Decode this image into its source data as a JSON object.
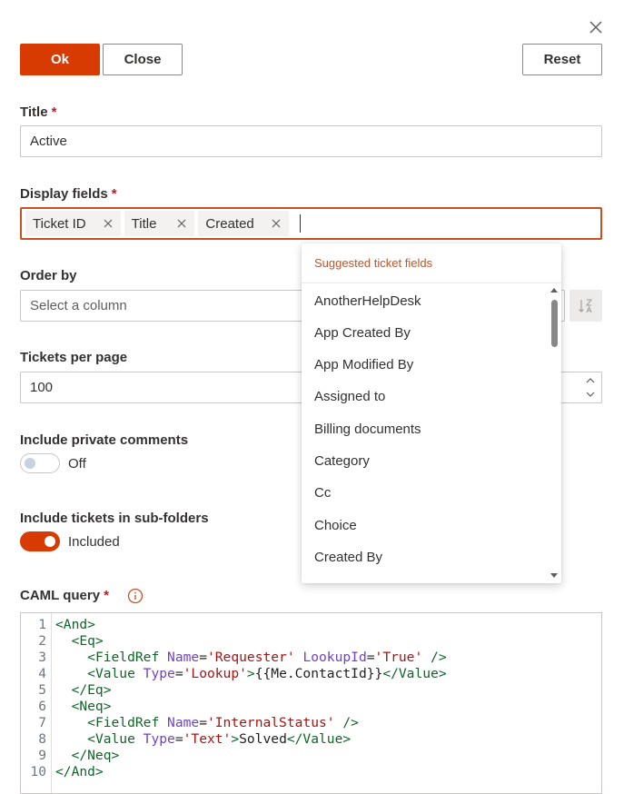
{
  "toolbar": {
    "ok_label": "Ok",
    "close_label": "Close",
    "reset_label": "Reset"
  },
  "title_field": {
    "label": "Title",
    "required_mark": "*",
    "value": "Active"
  },
  "display_fields": {
    "label": "Display fields",
    "required_mark": "*",
    "tags": [
      "Ticket ID",
      "Title",
      "Created"
    ]
  },
  "order_by": {
    "label": "Order by",
    "placeholder": "Select a column"
  },
  "tickets_per_page": {
    "label": "Tickets per page",
    "value": "100"
  },
  "private_comments": {
    "label": "Include private comments",
    "state": "Off"
  },
  "sub_folders": {
    "label": "Include tickets in sub-folders",
    "state": "Included"
  },
  "caml": {
    "label": "CAML query",
    "required_mark": "*",
    "line_numbers": [
      "1",
      "2",
      "3",
      "4",
      "5",
      "6",
      "7",
      "8",
      "9",
      "10"
    ],
    "lines": [
      [
        [
          "t",
          "<And>"
        ]
      ],
      [
        [
          "s",
          "  "
        ],
        [
          "t",
          "<Eq>"
        ]
      ],
      [
        [
          "s",
          "    "
        ],
        [
          "t",
          "<FieldRef "
        ],
        [
          "a",
          "Name"
        ],
        [
          "x",
          "="
        ],
        [
          "v",
          "'Requester'"
        ],
        [
          "x",
          " "
        ],
        [
          "a",
          "LookupId"
        ],
        [
          "x",
          "="
        ],
        [
          "v",
          "'True'"
        ],
        [
          "t",
          " />"
        ]
      ],
      [
        [
          "s",
          "    "
        ],
        [
          "t",
          "<Value "
        ],
        [
          "a",
          "Type"
        ],
        [
          "x",
          "="
        ],
        [
          "v",
          "'Lookup'"
        ],
        [
          "t",
          ">"
        ],
        [
          "x",
          "{{Me.ContactId}}"
        ],
        [
          "t",
          "</Value>"
        ]
      ],
      [
        [
          "s",
          "  "
        ],
        [
          "t",
          "</Eq>"
        ]
      ],
      [
        [
          "s",
          "  "
        ],
        [
          "t",
          "<Neq>"
        ]
      ],
      [
        [
          "s",
          "    "
        ],
        [
          "t",
          "<FieldRef "
        ],
        [
          "a",
          "Name"
        ],
        [
          "x",
          "="
        ],
        [
          "v",
          "'InternalStatus'"
        ],
        [
          "t",
          " />"
        ]
      ],
      [
        [
          "s",
          "    "
        ],
        [
          "t",
          "<Value "
        ],
        [
          "a",
          "Type"
        ],
        [
          "x",
          "="
        ],
        [
          "v",
          "'Text'"
        ],
        [
          "t",
          ">"
        ],
        [
          "x",
          "Solved"
        ],
        [
          "t",
          "</Value>"
        ]
      ],
      [
        [
          "s",
          "  "
        ],
        [
          "t",
          "</Neq>"
        ]
      ],
      [
        [
          "t",
          "</And>"
        ]
      ]
    ]
  },
  "suggestions": {
    "header": "Suggested ticket fields",
    "items": [
      "AnotherHelpDesk",
      "App Created By",
      "App Modified By",
      "Assigned to",
      "Billing documents",
      "Category",
      "Cc",
      "Choice",
      "Created By"
    ]
  },
  "colors": {
    "accent": "#d83b01",
    "focus_border": "#c7511f",
    "required": "#a4262c",
    "code_tag": "#116329",
    "code_attr": "#6f42c1",
    "code_string": "#a31515"
  },
  "icons": {
    "close": "close-icon",
    "tag_remove": "close-icon",
    "sort": "sort-ascending-icon",
    "spinner_up": "chevron-up-icon",
    "spinner_down": "chevron-down-icon",
    "info": "info-icon"
  }
}
